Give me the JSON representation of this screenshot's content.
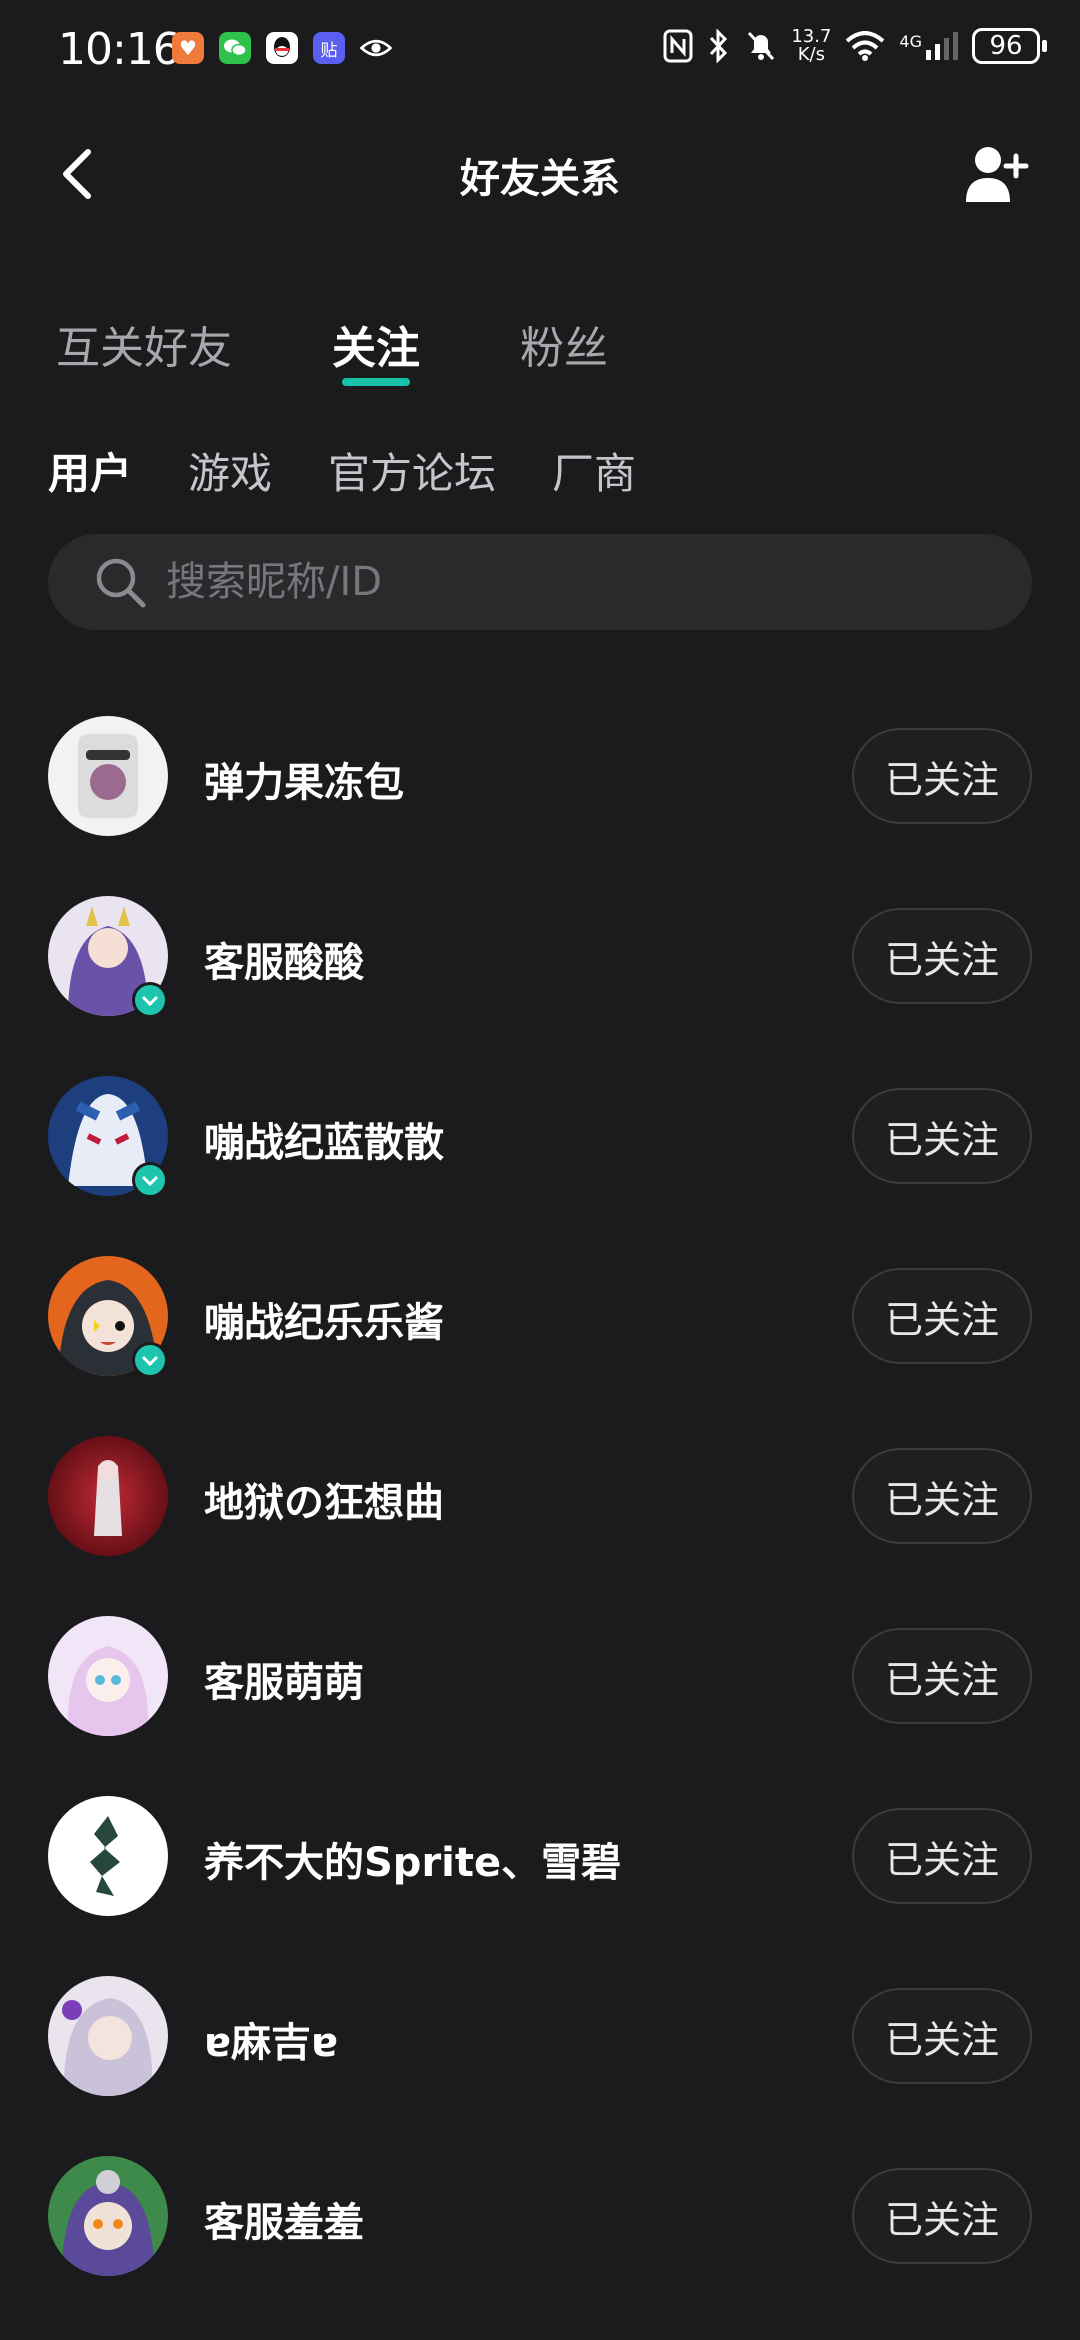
{
  "status_bar": {
    "time": "10:16",
    "net_speed_value": "13.7",
    "net_speed_unit": "K/s",
    "network": "4G",
    "battery": "96",
    "app_icons": [
      "heart-app-icon",
      "wechat-icon",
      "qq-icon",
      "tieba-icon",
      "eye-icon"
    ]
  },
  "header": {
    "title": "好友关系"
  },
  "main_tabs": [
    {
      "label": "互关好友",
      "active": false
    },
    {
      "label": "关注",
      "active": true
    },
    {
      "label": "粉丝",
      "active": false
    }
  ],
  "sub_tabs": [
    {
      "label": "用户",
      "active": true
    },
    {
      "label": "游戏",
      "active": false
    },
    {
      "label": "官方论坛",
      "active": false
    },
    {
      "label": "厂商",
      "active": false
    }
  ],
  "search": {
    "placeholder": "搜索昵称/ID"
  },
  "following": {
    "button_label": "已关注",
    "users": [
      {
        "name": "弹力果冻包",
        "verified": false,
        "avatar_color": "#f2f2f2"
      },
      {
        "name": "客服酸酸",
        "verified": true,
        "avatar_color": "#6a52a8"
      },
      {
        "name": "嘣战纪蓝散散",
        "verified": true,
        "avatar_color": "#2c5fb0"
      },
      {
        "name": "嘣战纪乐乐酱",
        "verified": true,
        "avatar_color": "#e3661c"
      },
      {
        "name": "地狱の狂想曲",
        "verified": false,
        "avatar_color": "#8e1b22"
      },
      {
        "name": "客服萌萌",
        "verified": false,
        "avatar_color": "#e7d3f2"
      },
      {
        "name": "养不大的Sprite、雪碧",
        "verified": false,
        "avatar_color": "#ffffff"
      },
      {
        "name": "ɐ麻吉ɐ",
        "verified": false,
        "avatar_color": "#c9c2d8"
      },
      {
        "name": "客服羞羞",
        "verified": false,
        "avatar_color": "#3e8a4a"
      }
    ]
  },
  "colors": {
    "background": "#1b1b1d",
    "accent": "#17c3a6",
    "search_bg": "#2a2a2d"
  }
}
